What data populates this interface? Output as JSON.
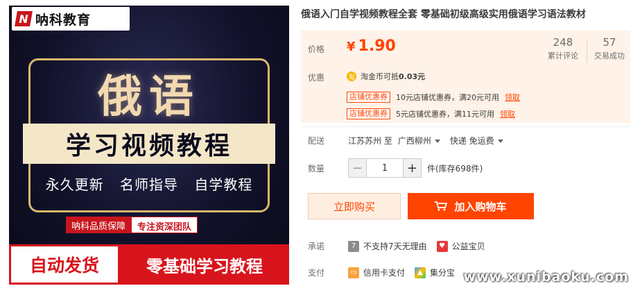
{
  "product_image": {
    "logo_mark": "N",
    "logo_text": "呐科教育",
    "big_title": "俄语",
    "subtitle": "学习视频教程",
    "features": [
      "永久更新",
      "名师指导",
      "自学教程"
    ],
    "guarantee_left": "呐科品质保障",
    "guarantee_right": "专注资深团队",
    "banner_left": "自动发货",
    "banner_right": "零基础学习教程"
  },
  "title": "俄语入门自学视频教程全套 零基础初级高级实用俄语学习语法教材",
  "price": {
    "label": "价格",
    "currency": "¥",
    "value": "1.90",
    "reviews_count": "248",
    "reviews_label": "累计评论",
    "sales_count": "57",
    "sales_label": "交易成功"
  },
  "promo": {
    "label": "优惠",
    "coin_icon": "淘",
    "coin_text": "淘金币可抵",
    "coin_amount": "0.03元",
    "coupons": [
      {
        "tag": "店铺优惠券",
        "text": "10元店铺优惠券，满20元可用",
        "link": "领取"
      },
      {
        "tag": "店铺优惠券",
        "text": "5元店铺优惠券，满11元可用",
        "link": "领取"
      }
    ]
  },
  "shipping": {
    "label": "配送",
    "from": "江苏苏州 至",
    "to": "广西柳州",
    "method": "快递 免运费"
  },
  "quantity": {
    "label": "数量",
    "minus": "−",
    "value": "1",
    "plus": "+",
    "stock": "件(库存698件)"
  },
  "buttons": {
    "buy_now": "立即购买",
    "add_to_cart": "加入购物车"
  },
  "promise": {
    "label": "承诺",
    "items": [
      "不支持7天无理由",
      "公益宝贝"
    ]
  },
  "payment": {
    "label": "支付",
    "items": [
      "信用卡支付",
      "集分宝"
    ]
  },
  "watermark": "www.xunibaoku.com",
  "colors": {
    "accent": "#ff4400",
    "price_panel_bg": "#fff2e8"
  }
}
